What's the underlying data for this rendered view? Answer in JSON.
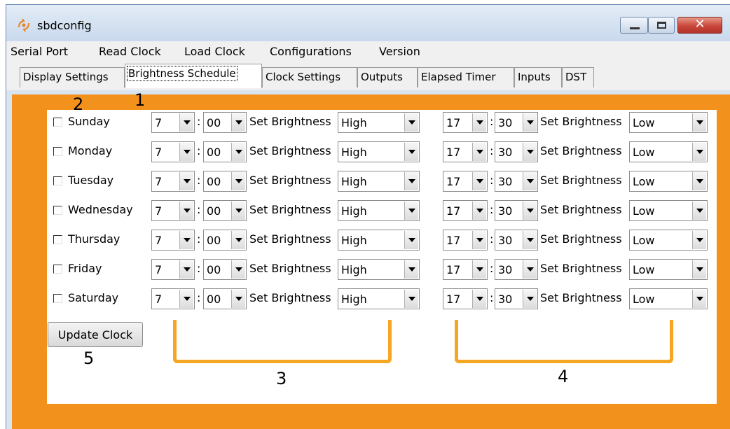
{
  "window": {
    "title": "sbdconfig",
    "icon": "sbd-app-icon",
    "close_label": "✕"
  },
  "menu": [
    "Serial Port",
    "Read Clock",
    "Load Clock",
    "Configurations",
    "Version"
  ],
  "tabs": [
    "Display Settings",
    "Brightness Schedule",
    "Clock Settings",
    "Outputs",
    "Elapsed Timer",
    "Inputs",
    "DST"
  ],
  "active_tab": "Brightness Schedule",
  "schedule": {
    "set_label": "Set Brightness",
    "rows": [
      {
        "day": "Sunday",
        "checked": false,
        "hour1": "7",
        "min1": "00",
        "level1": "High",
        "hour2": "17",
        "min2": "30",
        "level2": "Low"
      },
      {
        "day": "Monday",
        "checked": false,
        "hour1": "7",
        "min1": "00",
        "level1": "High",
        "hour2": "17",
        "min2": "30",
        "level2": "Low"
      },
      {
        "day": "Tuesday",
        "checked": false,
        "hour1": "7",
        "min1": "00",
        "level1": "High",
        "hour2": "17",
        "min2": "30",
        "level2": "Low"
      },
      {
        "day": "Wednesday",
        "checked": false,
        "hour1": "7",
        "min1": "00",
        "level1": "High",
        "hour2": "17",
        "min2": "30",
        "level2": "Low"
      },
      {
        "day": "Thursday",
        "checked": false,
        "hour1": "7",
        "min1": "00",
        "level1": "High",
        "hour2": "17",
        "min2": "30",
        "level2": "Low"
      },
      {
        "day": "Friday",
        "checked": false,
        "hour1": "7",
        "min1": "00",
        "level1": "High",
        "hour2": "17",
        "min2": "30",
        "level2": "Low"
      },
      {
        "day": "Saturday",
        "checked": false,
        "hour1": "7",
        "min1": "00",
        "level1": "High",
        "hour2": "17",
        "min2": "30",
        "level2": "Low"
      }
    ],
    "update_button": "Update Clock"
  },
  "annotations": [
    "1",
    "2",
    "3",
    "4",
    "5"
  ],
  "colors": {
    "panel": "#f2921c",
    "bracket": "#f5a623",
    "close": "#c9473a"
  }
}
